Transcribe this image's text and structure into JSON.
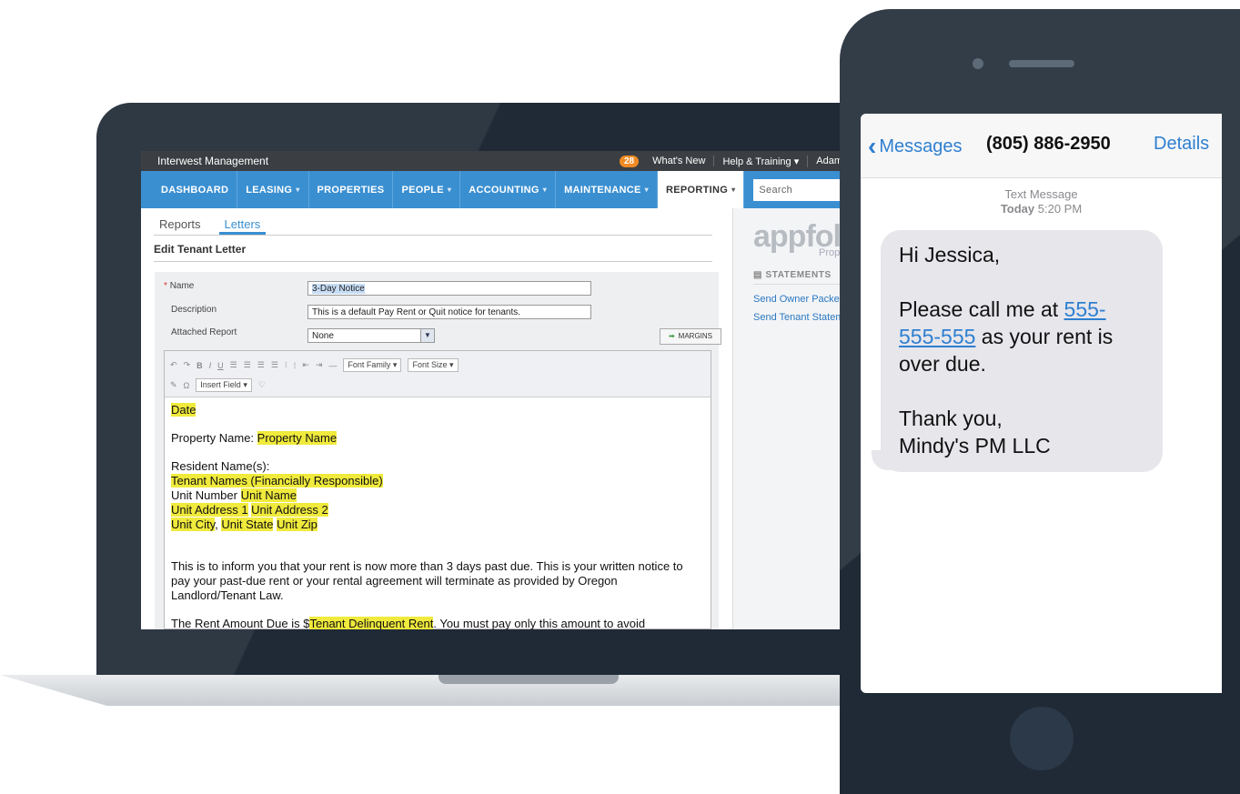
{
  "app": {
    "brand": "Interwest Management",
    "notifications_count": "28",
    "whats_new": "What's New",
    "help": "Help & Training",
    "user": "Adam"
  },
  "nav": {
    "items": [
      {
        "label": "DASHBOARD",
        "caret": false,
        "active": false
      },
      {
        "label": "LEASING",
        "caret": true,
        "active": false
      },
      {
        "label": "PROPERTIES",
        "caret": false,
        "active": false
      },
      {
        "label": "PEOPLE",
        "caret": true,
        "active": false
      },
      {
        "label": "ACCOUNTING",
        "caret": true,
        "active": false
      },
      {
        "label": "MAINTENANCE",
        "caret": true,
        "active": false
      },
      {
        "label": "REPORTING",
        "caret": true,
        "active": true
      }
    ],
    "search_placeholder": "Search"
  },
  "tabs": {
    "reports": "Reports",
    "letters": "Letters"
  },
  "page_title": "Edit Tenant Letter",
  "form": {
    "name_label": "Name",
    "name_value": "3-Day Notice",
    "description_label": "Description",
    "description_value": "This is a default Pay Rent or Quit notice for tenants.",
    "attached_report_label": "Attached Report",
    "attached_report_value": "None",
    "margins_button": "MARGINS"
  },
  "toolbar": {
    "font_family": "Font Family",
    "font_size": "Font Size",
    "insert_field": "Insert Field"
  },
  "letter": {
    "date_field": "Date",
    "property_label": "Property Name: ",
    "property_field": "Property Name",
    "resident_label": "Resident Name(s):",
    "tenant_names_field": "Tenant Names (Financially Responsible)",
    "unit_number_label": "Unit Number ",
    "unit_name_field": "Unit Name",
    "unit_address1_field": "Unit Address 1",
    "unit_address2_field": "Unit Address 2",
    "unit_city_field": "Unit City",
    "unit_state_field": "Unit State",
    "unit_zip_field": "Unit Zip",
    "notice_text": "This is to inform you that your rent is now more than 3 days past due. This is your written notice to pay your past-due rent or your rental agreement will terminate as provided by Oregon Landlord/Tenant Law.",
    "amount_prefix": "The Rent Amount Due is $",
    "amount_field": "Tenant Delinquent Rent",
    "amount_suffix": ". You must pay only this amount to avoid"
  },
  "sidebar": {
    "logo": "appfolio",
    "logo_sub": "Property",
    "section": "STATEMENTS",
    "links": [
      "Send Owner Packet",
      "Send Tenant Statement"
    ]
  },
  "messages": {
    "back_label": "Messages",
    "phone_number": "(805) 886-2950",
    "details_label": "Details",
    "meta_type": "Text Message",
    "meta_day": "Today",
    "meta_time": "5:20 PM",
    "greeting": "Hi Jessica,",
    "body_prefix": "Please call me at ",
    "phone_link": "555-555-555",
    "body_suffix": " as your rent is over due.",
    "signoff_1": "Thank you,",
    "signoff_2": "Mindy's PM LLC"
  },
  "colors": {
    "nav_blue": "#3a8fd1",
    "highlight": "#f0ea3c",
    "ios_blue": "#2f7fd0",
    "device_dark": "#1f2a36"
  }
}
